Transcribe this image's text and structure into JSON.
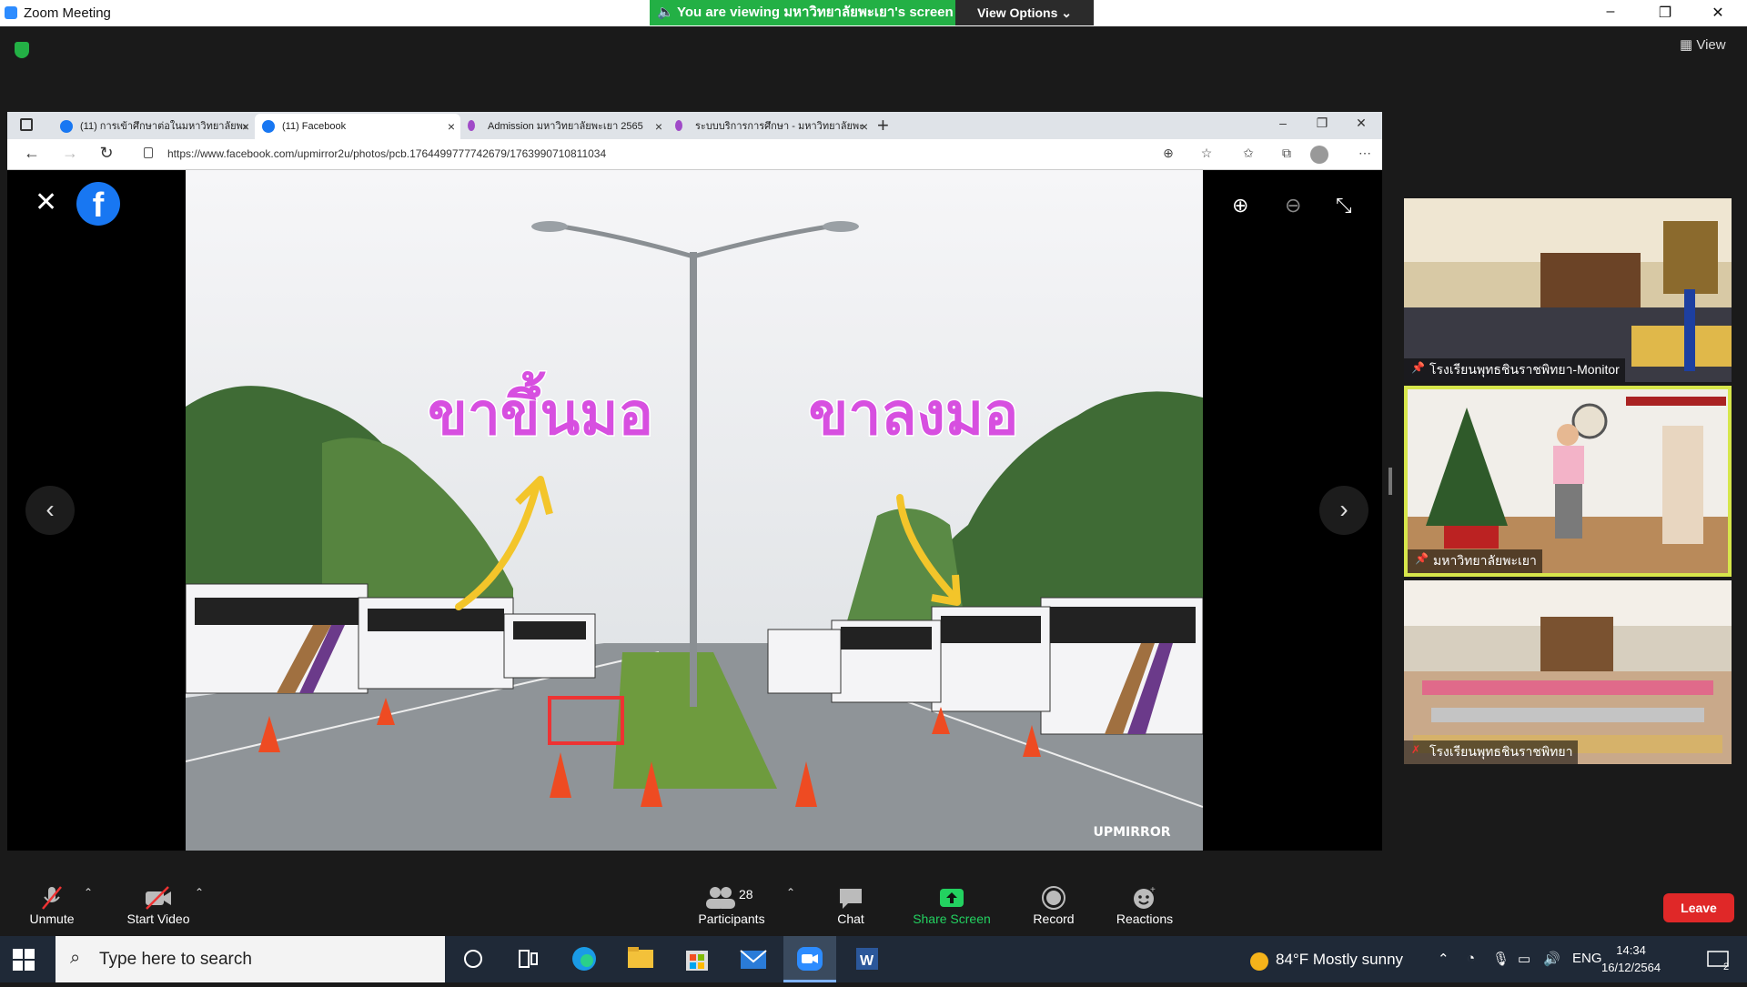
{
  "zoom": {
    "window_title": "Zoom Meeting",
    "share_banner": "You are viewing มหาวิทยาลัยพะเยา's screen",
    "view_options": "View Options",
    "view_label": "View",
    "win_min": "–",
    "win_restore": "❐",
    "win_close": "✕"
  },
  "browser": {
    "tabs": [
      {
        "label": "(11) การเข้าศึกษาต่อในมหาวิทยาลัยพะ",
        "favicon": "facebook-icon"
      },
      {
        "label": "(11) Facebook",
        "favicon": "facebook-icon",
        "active": true
      },
      {
        "label": "Admission มหาวิทยาลัยพะเยา 2565",
        "favicon": "up-icon"
      },
      {
        "label": "ระบบบริการการศึกษา - มหาวิทยาลัยพะ",
        "favicon": "up-icon"
      }
    ],
    "url": "https://www.facebook.com/upmirror2u/photos/pcb.1764499777742679/1763990710811034",
    "photo_text_left": "ขาขึ้นมอ",
    "photo_text_right": "ขาลงมอ",
    "photo_watermark": "UPMIRROR"
  },
  "participants_tiles": [
    {
      "name": "โรงเรียนพุทธชินราชพิทยา-Monitor"
    },
    {
      "name": "มหาวิทยาลัยพะเยา",
      "active": true
    },
    {
      "name": "โรงเรียนพุทธชินราชพิทยา"
    }
  ],
  "toolbar": {
    "unmute": "Unmute",
    "start_video": "Start Video",
    "participants": "Participants",
    "participants_count": "28",
    "chat": "Chat",
    "share_screen": "Share Screen",
    "record": "Record",
    "reactions": "Reactions",
    "leave": "Leave"
  },
  "taskbar": {
    "search_placeholder": "Type here to search",
    "weather": "84°F  Mostly sunny",
    "lang": "ENG",
    "time": "14:34",
    "date": "16/12/2564",
    "notif_count": "2"
  },
  "colors": {
    "zoom_green": "#23b045",
    "leave_red": "#e02828",
    "active_speaker": "#d7e64b"
  }
}
